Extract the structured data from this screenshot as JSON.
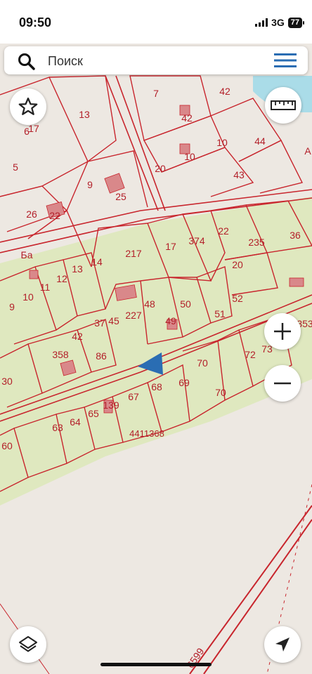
{
  "status_bar": {
    "time": "09:50",
    "network": "3G",
    "battery": "77"
  },
  "search": {
    "placeholder": "Поиск"
  },
  "map": {
    "cadastral_block": "4411368",
    "parcel_numbers": [
      "7",
      "42",
      "13",
      "6",
      "17",
      "42",
      "10",
      "5",
      "44",
      "9",
      "25",
      "20",
      "10",
      "43",
      "26",
      "22",
      "217",
      "17",
      "374",
      "22",
      "235",
      "36",
      "14",
      "13",
      "12",
      "20",
      "11",
      "52",
      "10",
      "9",
      "48",
      "50",
      "227",
      "45",
      "37",
      "49",
      "51",
      "42",
      "86",
      "358",
      "73",
      "72",
      "70",
      "69",
      "68",
      "67",
      "139",
      "65",
      "64",
      "63",
      "30",
      "60",
      "70",
      "353",
      "6599",
      "А",
      "Ба"
    ],
    "colors": {
      "parcel_fill": "#dfe8bf",
      "parcel_border": "#c8252d",
      "building": "#d9888a",
      "water": "#aadce8",
      "background": "#ede8e2",
      "location_arrow": "#2a6db3"
    }
  },
  "controls": {
    "favorites": "star-icon",
    "ruler": "ruler-icon",
    "zoom_in": "plus-icon",
    "zoom_out": "minus-icon",
    "layers": "layers-icon",
    "locate": "navigation-arrow-icon"
  }
}
